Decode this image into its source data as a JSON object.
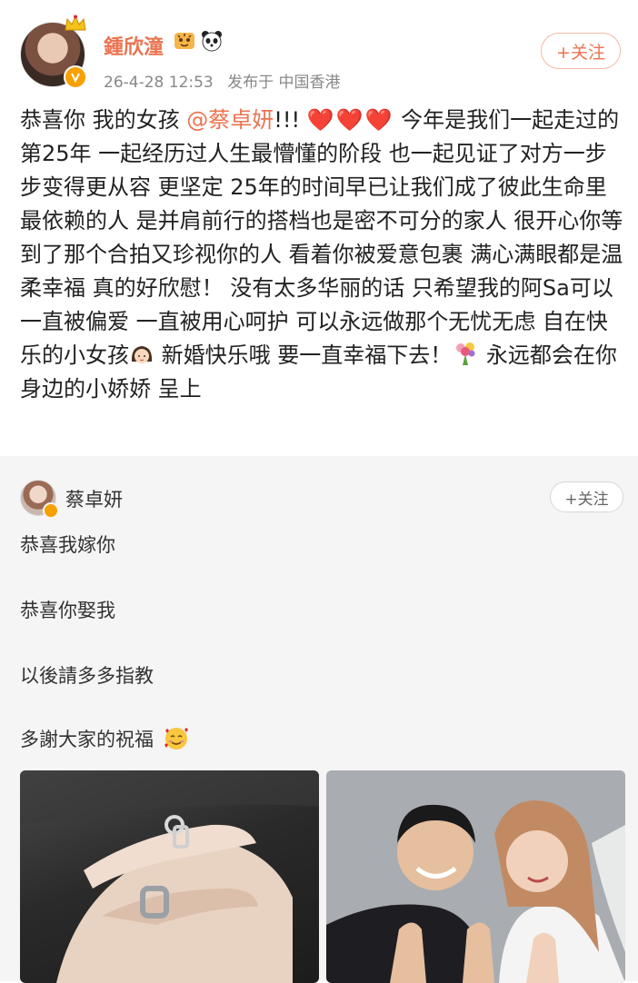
{
  "post": {
    "author_name": "鍾欣潼",
    "timestamp": "26-4-28 12:53",
    "location": "发布于 中国香港",
    "follow_label": "+关注",
    "text_parts": {
      "p1": "恭喜你 我的女孩",
      "mention": "@蔡卓妍",
      "p2": "!!!",
      "hearts": "❤️❤️❤️",
      "p3": " 今年是我们一起走过的第25年 一起经历过人生最懵懂的阶段 也一起见证了对方一步步变得更从容 更坚定  25年的时间早已让我们成了彼此生命里最依赖的人 是并肩前行的搭档也是密不可分的家人  很开心你等到了那个合拍又珍视你的人 看着你被爱意包裹 满心满眼都是温柔幸福 真的好欣慰！ 没有太多华丽的话 只希望我的阿Sa可以一直被偏爱 一直被用心呵护 可以永远做那个无忧无虑 自在快乐的小女孩",
      "p4": " 新婚快乐哦 要一直幸福下去！",
      "p5": "                  永远都会在你身边的小娇娇 呈上"
    },
    "icons": [
      "crown-icon",
      "tiger-badge-icon",
      "panda-badge-icon",
      "verified-badge-icon",
      "girl-emoji-icon",
      "bouquet-emoji-icon"
    ]
  },
  "repost": {
    "author_name": "蔡卓妍",
    "follow_label": "+关注",
    "lines": [
      "恭喜我嫁你",
      "恭喜你娶我",
      "以後請多多指教",
      "多謝大家的祝福"
    ],
    "icons": [
      "smiling-hearts-emoji-icon",
      "verified-badge-icon"
    ]
  },
  "colors": {
    "accent": "#eb7350",
    "heart": "#e0282e",
    "verified": "#f7a100",
    "repost_bg": "#f5f5f5"
  }
}
